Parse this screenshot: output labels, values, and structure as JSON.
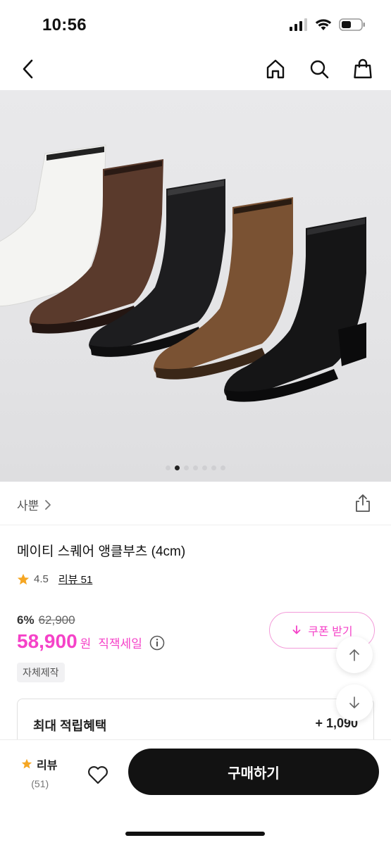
{
  "status": {
    "time": "10:56"
  },
  "brand": {
    "name": "사뿐"
  },
  "product": {
    "title": "메이티 스퀘어 앵클부츠 (4cm)",
    "rating": "4.5",
    "review_label": "리뷰 51",
    "discount": "6%",
    "original_price": "62,900",
    "price": "58,900",
    "currency": "원",
    "sale_label": "직잭세일",
    "tag": "자체제작"
  },
  "coupon": {
    "label": "쿠폰 받기"
  },
  "benefit": {
    "label": "최대 적립혜택",
    "value": "+ 1,090"
  },
  "gallery": {
    "total": 7,
    "active_index": 1
  },
  "bottom": {
    "review_label": "리뷰",
    "review_count": "(51)",
    "buy_label": "구매하기"
  },
  "colors": {
    "accent": "#f542c8",
    "buy_button": "#121212",
    "star": "#f5a623"
  }
}
